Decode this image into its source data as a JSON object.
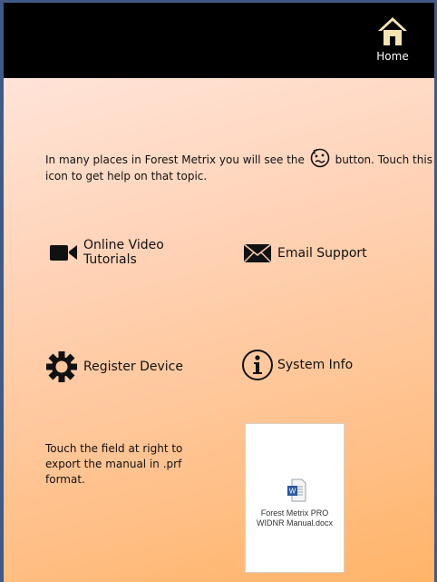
{
  "header": {
    "home_label": "Home"
  },
  "intro": {
    "text_before": "In many places in Forest Metrix you will see the",
    "text_after": "button. Touch this icon to get help on that topic."
  },
  "tiles": {
    "video_label_line1": "Online Video",
    "video_label_line2": "Tutorials",
    "email_label": "Email Support",
    "register_label": "Register Device",
    "sysinfo_label": "System Info"
  },
  "export": {
    "instructions": "Touch the field at right to export the manual in .prf format.",
    "file_name_line1": "Forest Metrix PRO",
    "file_name_line2": "WIDNR Manual.docx",
    "file_icon_letter": "W"
  },
  "colors": {
    "header_bg": "#000000",
    "border": "#3f5a87",
    "bg_gradient_start": "#ffe4d8",
    "bg_gradient_end": "#ffb468",
    "word_blue": "#2b579a"
  }
}
